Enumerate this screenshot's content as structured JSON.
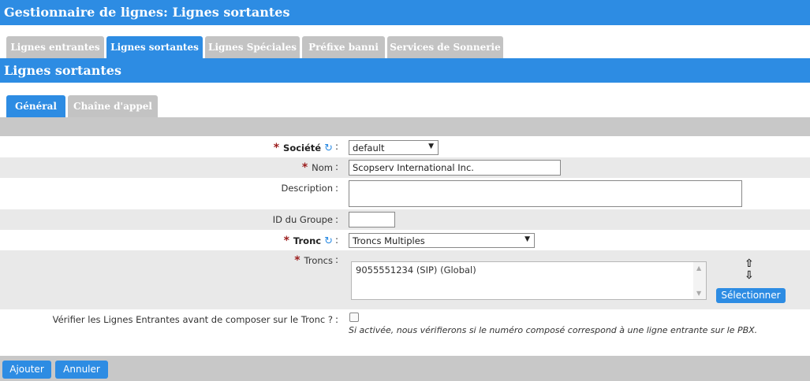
{
  "header": {
    "title": "Gestionnaire de lignes:  Lignes sortantes"
  },
  "main_tabs": [
    {
      "label": "Lignes entrantes",
      "active": false
    },
    {
      "label": "Lignes sortantes",
      "active": true
    },
    {
      "label": "Lignes Spéciales",
      "active": false
    },
    {
      "label": "Préfixe banni",
      "active": false
    },
    {
      "label": "Services de Sonnerie",
      "active": false
    }
  ],
  "section": {
    "title": "Lignes sortantes"
  },
  "sub_tabs": [
    {
      "label": "Général",
      "active": true
    },
    {
      "label": "Chaîne d'appel",
      "active": false
    }
  ],
  "form": {
    "required_mark": "*",
    "colon": ":",
    "societe": {
      "label": "Société",
      "value": "default"
    },
    "nom": {
      "label": "Nom",
      "value": "Scopserv International Inc."
    },
    "description": {
      "label": "Description",
      "value": ""
    },
    "id_groupe": {
      "label": "ID du Groupe",
      "value": ""
    },
    "tronc": {
      "label": "Tronc",
      "value": "Troncs Multiples"
    },
    "troncs": {
      "label": "Troncs",
      "items": [
        "9055551234 (SIP) (Global)"
      ],
      "select_button": "Sélectionner"
    },
    "verifier": {
      "label": "Vérifier les Lignes Entrantes avant de composer sur le Tronc ?",
      "checked": false,
      "help": "Si activée, nous vérifierons si le numéro composé correspond à une ligne entrante sur le PBX."
    }
  },
  "footer": {
    "add_label": "Ajouter",
    "cancel_label": "Annuler"
  },
  "colors": {
    "accent": "#2d8ce3",
    "tab_inactive": "#c3c3c3",
    "required": "#9b1c1c"
  }
}
